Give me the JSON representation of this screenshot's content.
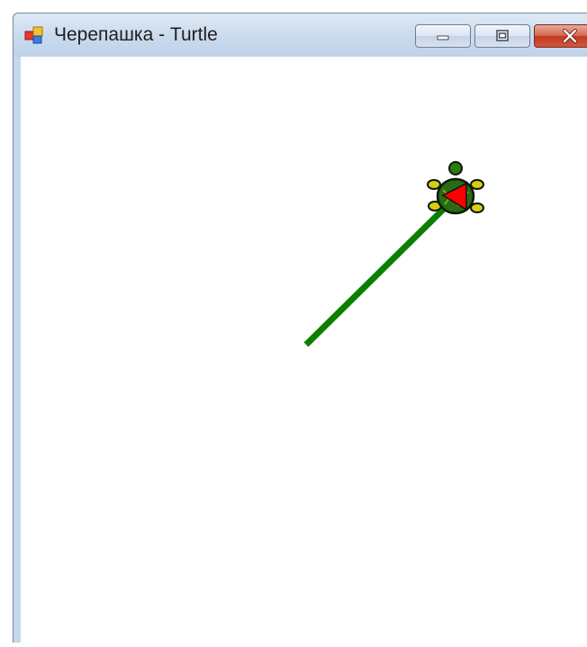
{
  "window": {
    "title": "Черепашка - Turtle",
    "icon": "app-icon",
    "controls": {
      "minimize_icon": "minimize-icon",
      "maximize_icon": "maximize-icon",
      "close_icon": "close-icon"
    }
  },
  "canvas": {
    "background": "#ffffff",
    "path_color": "#0a8000",
    "turtle": {
      "icon": "turtle-icon",
      "body_color": "#2a6a12",
      "head_marker_color": "#ff0000"
    }
  }
}
